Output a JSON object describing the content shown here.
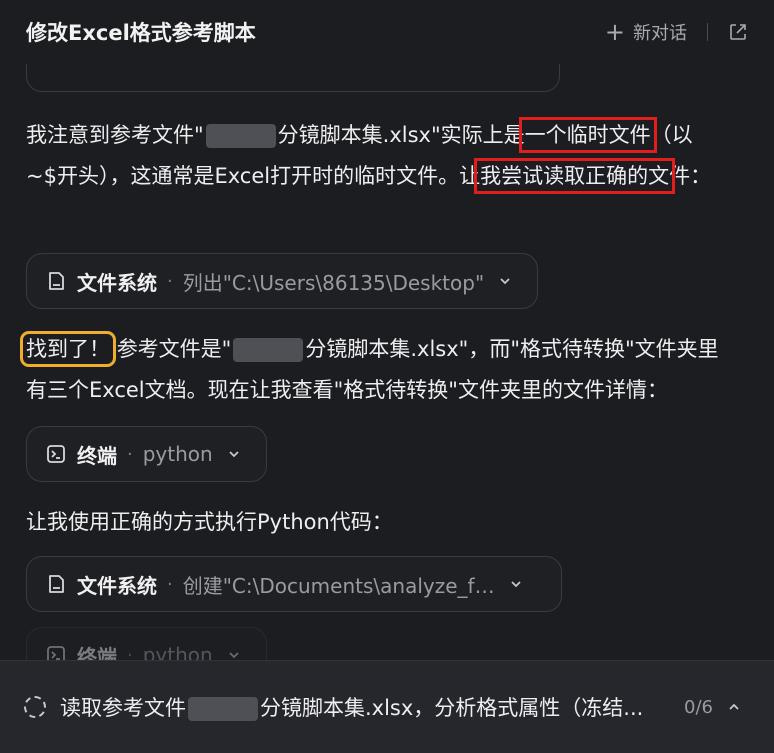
{
  "header": {
    "title": "修改Excel格式参考脚本",
    "new_chat_label": "新对话"
  },
  "messages": {
    "p1_a": "我注意到参考文件\"",
    "p1_b": "分镜脚本集.xlsx\"实际上是",
    "p1_highlight1": "一个临时文件",
    "p1_c": "（以~$开头），这通常是Excel打开时的临时文件。让",
    "p1_highlight2": "我尝试读取正确的文",
    "p1_d": "件：",
    "p2_highlight": "找到了！",
    "p2_a": "参考文件是\"",
    "p2_b": "分镜脚本集.xlsx\"，而\"格式待转换\"文件夹里有三个Excel文档。现在让我查看\"格式待转换\"文件夹里的文件详情：",
    "p3": "让我使用正确的方式执行Python代码："
  },
  "tools": [
    {
      "name": "文件系统",
      "detail": "列出\"C:\\Users\\86135\\Desktop\"",
      "icon": "file-icon"
    },
    {
      "name": "终端",
      "detail": "python",
      "icon": "terminal-icon"
    },
    {
      "name": "文件系统",
      "detail": "创建\"C:\\Documents\\analyze_f…",
      "icon": "file-icon"
    },
    {
      "name": "终端",
      "detail": "python",
      "icon": "terminal-icon"
    }
  ],
  "bottom": {
    "task_a": "读取参考文件",
    "task_b": "分镜脚本集.xlsx，分析格式属性（冻结...",
    "progress": "0/6"
  },
  "colors": {
    "background": "#1c1d21",
    "highlight_red": "#e11d1d",
    "highlight_orange": "#f0ad2d"
  }
}
